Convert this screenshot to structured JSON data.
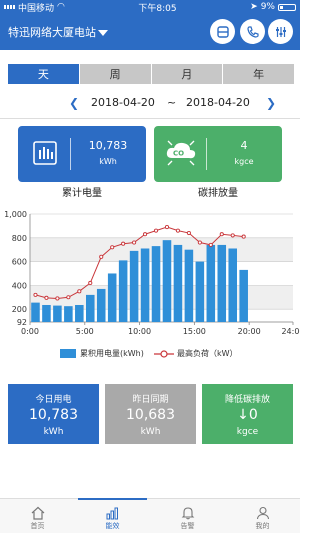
{
  "status": {
    "carrier": "中国移动",
    "time": "下午8:05",
    "battery": "9%"
  },
  "header": {
    "station": "特迅网络大厦电站"
  },
  "tabs": [
    {
      "label": "天",
      "active": true
    },
    {
      "label": "周",
      "active": false
    },
    {
      "label": "月",
      "active": false
    },
    {
      "label": "年",
      "active": false
    }
  ],
  "date_range": {
    "start": "2018-04-20",
    "separator": "~",
    "end": "2018-04-20"
  },
  "summary": {
    "energy": {
      "value": "10,783",
      "unit": "kWh",
      "label": "累计电量"
    },
    "carbon": {
      "value": "4",
      "unit": "kgce",
      "label": "碳排放量"
    }
  },
  "chart_data": {
    "type": "bar",
    "x": [
      0,
      1,
      2,
      3,
      4,
      5,
      6,
      7,
      8,
      9,
      10,
      11,
      12,
      13,
      14,
      15,
      16,
      17,
      18,
      19
    ],
    "x_tick_labels": [
      "0:00",
      "5:00",
      "10:00",
      "15:00",
      "20:00",
      "24:00"
    ],
    "x_ticks": [
      0,
      5,
      10,
      15,
      20,
      24
    ],
    "xlim": [
      0,
      24
    ],
    "y_tick_labels": [
      "92",
      "200",
      "400",
      "600",
      "800",
      "1,000"
    ],
    "y_ticks": [
      92,
      200,
      400,
      600,
      800,
      1000
    ],
    "ylim": [
      92,
      1000
    ],
    "grid": true,
    "legend_position": "bottom",
    "series": [
      {
        "name": "累积用电量(kWh)",
        "kind": "bar",
        "color": "#2f8fd8",
        "values": [
          255,
          235,
          230,
          225,
          235,
          320,
          370,
          500,
          610,
          690,
          710,
          730,
          780,
          740,
          700,
          600,
          740,
          740,
          710,
          530
        ]
      },
      {
        "name": "最高负荷（kW）",
        "kind": "line",
        "color": "#c9363a",
        "values": [
          320,
          295,
          290,
          300,
          350,
          420,
          640,
          720,
          750,
          760,
          830,
          860,
          890,
          860,
          840,
          760,
          740,
          830,
          820,
          810
        ]
      }
    ]
  },
  "comparison": [
    {
      "title": "今日用电",
      "value": "10,783",
      "unit": "kWh",
      "color": "#2c6cc4"
    },
    {
      "title": "昨日同期",
      "value": "10,683",
      "unit": "kWh",
      "color": "#a9a9a9"
    },
    {
      "title": "降低碳排放",
      "arrow": "↓",
      "value": "0",
      "unit": "kgce",
      "color": "#4caf6a"
    }
  ],
  "nav": [
    {
      "label": "首页",
      "icon": "home-icon",
      "active": false
    },
    {
      "label": "能效",
      "icon": "bar-chart-icon",
      "active": true
    },
    {
      "label": "告警",
      "icon": "bell-icon",
      "active": false
    },
    {
      "label": "我的",
      "icon": "user-icon",
      "active": false
    }
  ]
}
